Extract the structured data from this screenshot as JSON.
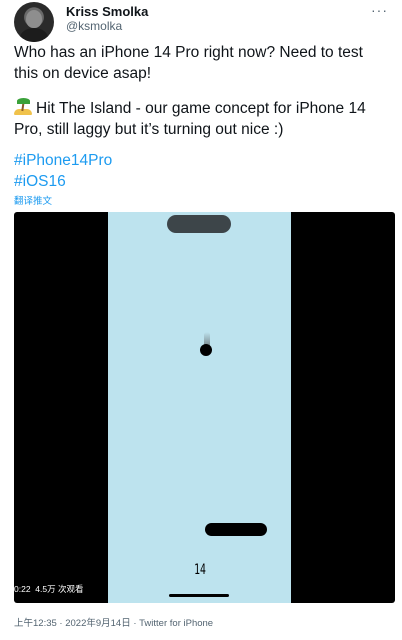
{
  "author": {
    "name": "Kriss Smolka",
    "handle": "@ksmolka"
  },
  "tweet": {
    "line1": "Who has an iPhone 14 Pro right now? Need to test this on device asap!",
    "line2": "Hit The Island - our game concept for iPhone 14 Pro, still laggy but it’s turning out nice :)",
    "emoji_icon": "desert-island-icon",
    "hashtags": [
      "#iPhone14Pro",
      "#iOS16"
    ],
    "translate": "翻译推文"
  },
  "video": {
    "duration": "0:22",
    "views": "4.5万 次观看",
    "score": "14"
  },
  "footer": {
    "time": "上午12:35 · 2022年9月14日 · ",
    "source": "Twitter for iPhone"
  },
  "colors": {
    "link": "#1d9bf0",
    "game_bg": "#bde3ee",
    "secondary_text": "#536471"
  }
}
